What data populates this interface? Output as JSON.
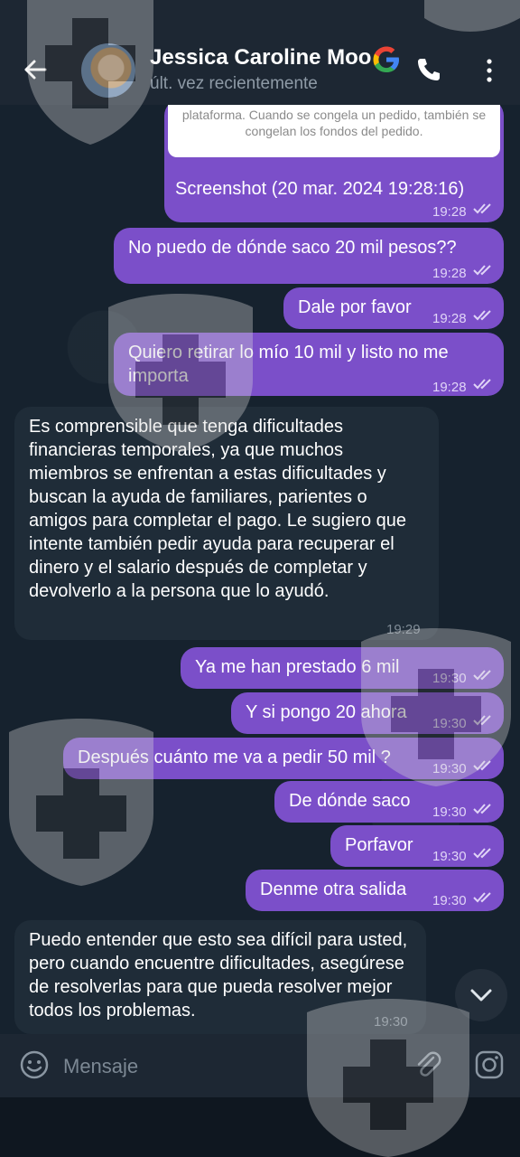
{
  "header": {
    "name": "Jessica Caroline Moo",
    "status": "últ. vez recientemente"
  },
  "messages": {
    "image_caption": "plataforma. Cuando se congela un pedido, también se congelan los fondos del pedido.",
    "m0_text": "Screenshot (20 mar. 2024 19:28:16)",
    "m0_time": "19:28",
    "m1_text": "No puedo de dónde saco 20 mil pesos??",
    "m1_time": "19:28",
    "m2_text": "Dale por favor",
    "m2_time": "19:28",
    "m3_text": "Quiero retirar lo mío 10 mil y listo no me importa",
    "m3_time": "19:28",
    "m4_text": "Es comprensible que tenga dificultades financieras temporales, ya que muchos miembros se enfrentan a estas dificultades y buscan la ayuda de familiares, parientes o amigos para completar el pago. Le sugiero que intente también pedir ayuda para recuperar el dinero y el salario después de completar y devolverlo a la persona que lo ayudó.",
    "m4_time": "19:29",
    "m5_text": "Ya me han prestado 6 mil",
    "m5_time": "19:30",
    "m6_text": "Y si pongo 20 ahora",
    "m6_time": "19:30",
    "m7_text": "Después cuánto me va a pedir 50 mil ?",
    "m7_time": "19:30",
    "m8_text": "De dónde saco",
    "m8_time": "19:30",
    "m9_text": "Porfavor",
    "m9_time": "19:30",
    "m10_text": "Denme otra salida",
    "m10_time": "19:30",
    "m11_text": "Puedo entender que esto sea difícil para usted, pero cuando encuentre dificultades, asegúrese de resolverlas para que pueda resolver mejor todos los problemas.",
    "m11_time": "19:30"
  },
  "composer": {
    "placeholder": "Mensaje"
  },
  "colors": {
    "outgoing_bubble": "#7b4fc9",
    "incoming_bubble": "#1f2c38",
    "header_bg": "#1d2733"
  },
  "icons": [
    "back-arrow-icon",
    "google-icon",
    "phone-icon",
    "more-vertical-icon",
    "emoji-icon",
    "paperclip-icon",
    "instagram-icon",
    "chevron-down-icon",
    "double-check-icon"
  ]
}
